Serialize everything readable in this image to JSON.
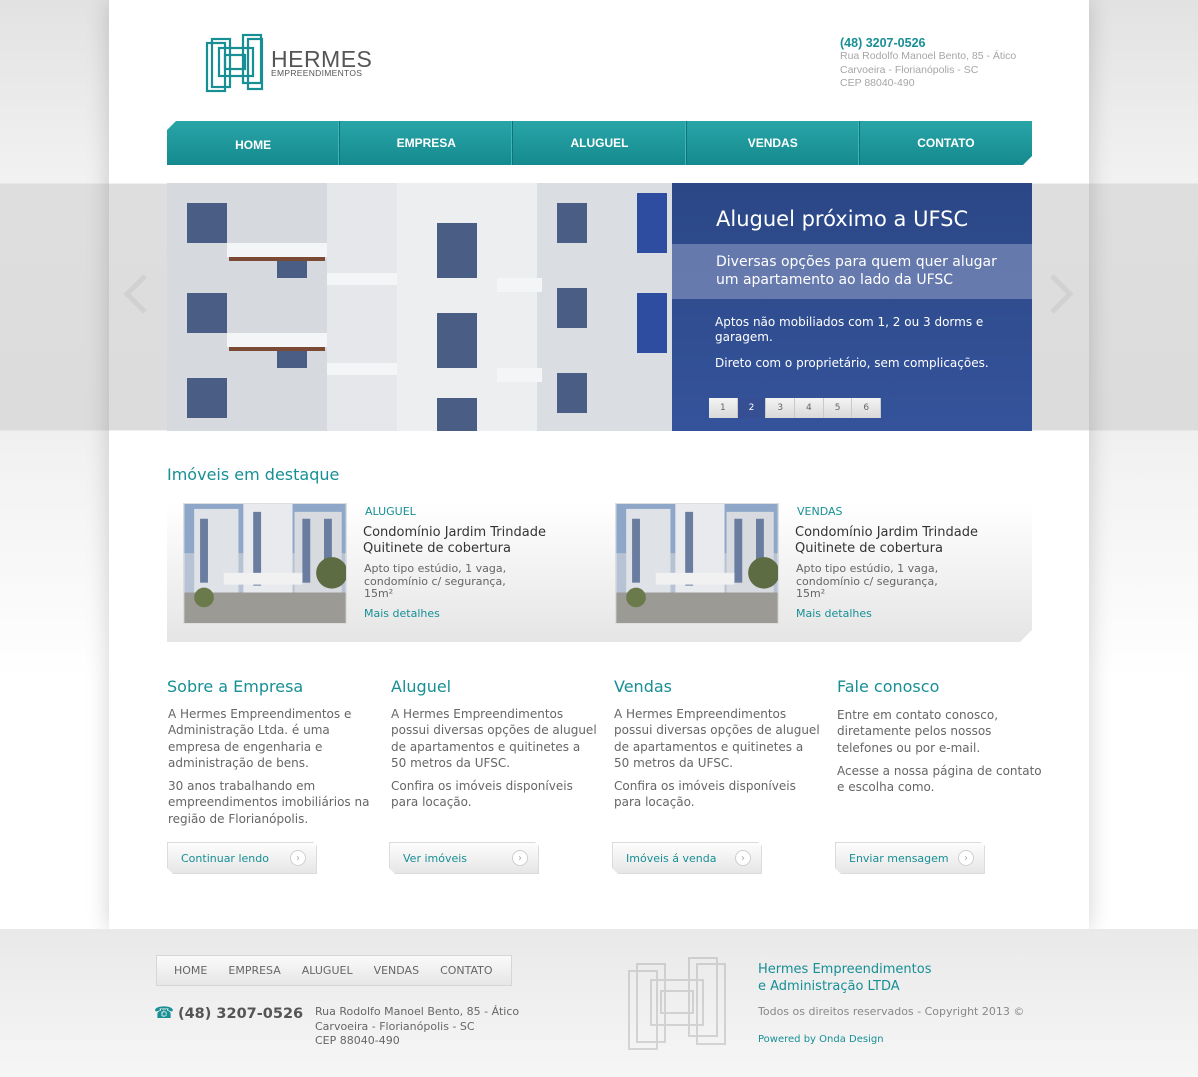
{
  "colors": {
    "accent": "#178f95",
    "nav": "#1a9397",
    "slide_box": "#2f4c8f"
  },
  "header": {
    "logo_title": "HERMES",
    "logo_subtitle": "EMPREENDIMENTOS",
    "phone": "(48) 3207-0526",
    "address_line1": "Rua Rodolfo Manoel Bento, 85 - Ático",
    "address_line2": "Carvoeira - Florianópolis - SC",
    "address_line3": "CEP 88040-490"
  },
  "nav": {
    "items": [
      {
        "label": "HOME"
      },
      {
        "label": "EMPRESA"
      },
      {
        "label": "ALUGUEL"
      },
      {
        "label": "VENDAS"
      },
      {
        "label": "CONTATO"
      }
    ]
  },
  "slider": {
    "title": "Aluguel próximo a UFSC",
    "subtitle_line1": "Diversas opções para quem quer alugar",
    "subtitle_line2": "um apartamento ao lado da UFSC",
    "text1": "Aptos não mobiliados com 1, 2 ou 3 dorms e garagem.",
    "text2": "Direto com o proprietário, sem complicações.",
    "pages": [
      "1",
      "2",
      "3",
      "4",
      "5",
      "6"
    ],
    "active_page": "2",
    "prev_icon": "chevron-left-icon",
    "next_icon": "chevron-right-icon"
  },
  "featured": {
    "title": "Imóveis em destaque",
    "items": [
      {
        "tag": "ALUGUEL",
        "title_line1": "Condomínio Jardim Trindade",
        "title_line2": "Quitinete de cobertura",
        "desc_line1": "Apto tipo estúdio, 1 vaga,",
        "desc_line2": "condomínio c/ segurança,",
        "desc_line3": "15m²",
        "link": "Mais detalhes"
      },
      {
        "tag": "VENDAS",
        "title_line1": "Condomínio Jardim Trindade",
        "title_line2": "Quitinete de cobertura",
        "desc_line1": "Apto tipo estúdio, 1 vaga,",
        "desc_line2": "condomínio c/ segurança,",
        "desc_line3": "15m²",
        "link": "Mais detalhes"
      }
    ]
  },
  "columns": [
    {
      "title": "Sobre a Empresa",
      "p1": [
        "A Hermes Empreendimentos e",
        "Administração Ltda. é uma",
        "empresa de engenharia e",
        "administração de bens."
      ],
      "p2": [
        "30 anos trabalhando em",
        "empreendimentos imobiliários na",
        "região de Florianópolis."
      ],
      "button": "Continuar lendo"
    },
    {
      "title": "Aluguel",
      "p1": [
        "A Hermes Empreendimentos",
        "possui diversas opções de aluguel",
        "de apartamentos e quitinetes a",
        "50 metros da UFSC."
      ],
      "p2": [
        "Confira os imóveis disponíveis",
        "para locação."
      ],
      "button": "Ver imóveis"
    },
    {
      "title": "Vendas",
      "p1": [
        "A Hermes Empreendimentos",
        "possui diversas opções de aluguel",
        "de apartamentos e quitinetes a",
        "50 metros da UFSC."
      ],
      "p2": [
        "Confira os imóveis disponíveis",
        "para locação."
      ],
      "button": "Imóveis á venda"
    },
    {
      "title": "Fale conosco",
      "p1": [
        "Entre em contato conosco,",
        "diretamente pelos nossos",
        "telefones ou por e-mail."
      ],
      "p2": [
        "Acesse a nossa página de contato",
        "e escolha como."
      ],
      "button": "Enviar mensagem"
    }
  ],
  "footer": {
    "nav": [
      "HOME",
      "EMPRESA",
      "ALUGUEL",
      "VENDAS",
      "CONTATO"
    ],
    "phone": "(48) 3207-0526",
    "address_line1": "Rua Rodolfo Manoel Bento, 85 - Ático",
    "address_line2": "Carvoeira - Florianópolis - SC",
    "address_line3": "CEP 88040-490",
    "company_line1": "Hermes Empreendimentos",
    "company_line2": "e Administração LTDA",
    "rights": "Todos os direitos reservados - Copyright 2013 ©",
    "powered": "Powered by Onda Design"
  }
}
